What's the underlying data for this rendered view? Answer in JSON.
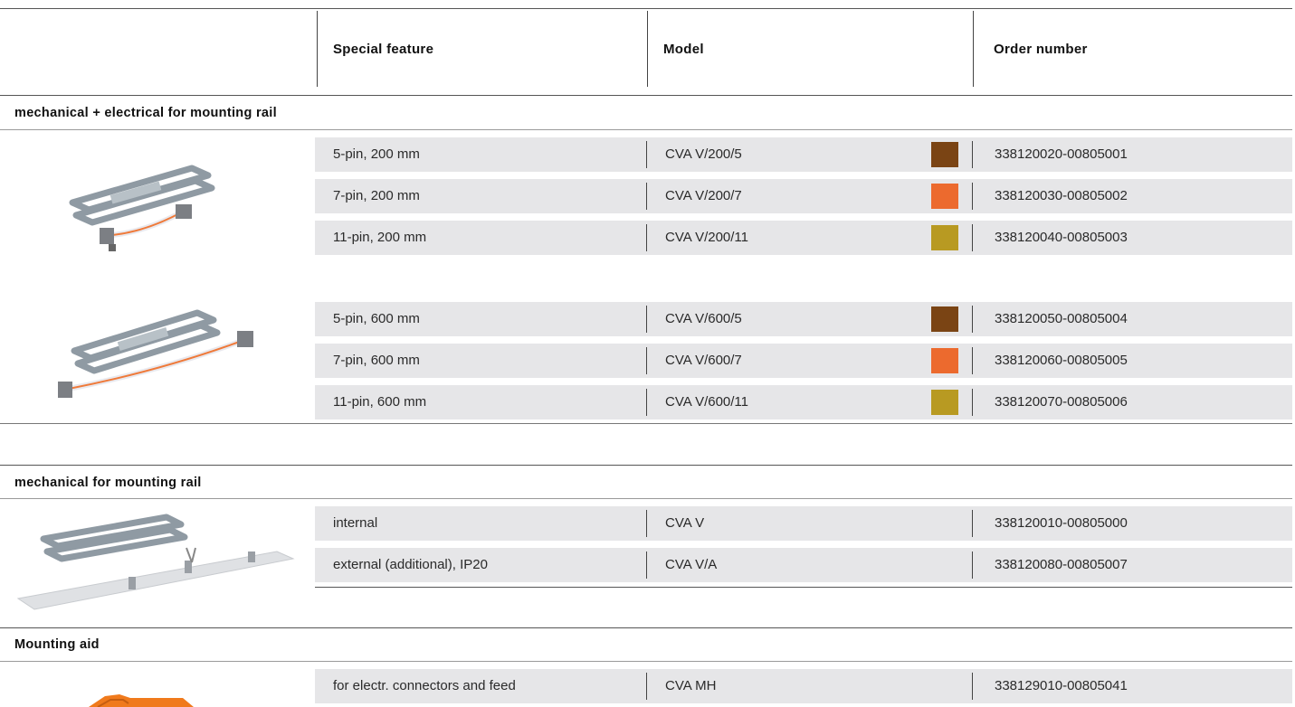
{
  "header": {
    "special_feature": "Special feature",
    "model": "Model",
    "order_number": "Order number"
  },
  "colors": {
    "brown": "#7a4414",
    "orange": "#ec6a2e",
    "ochre": "#b89a22",
    "row_bg": "#e6e6e8"
  },
  "sections": [
    {
      "title": "mechanical + electrical for mounting rail",
      "image_icon": "mounting-rail-connector-image",
      "rows": [
        {
          "feature": "5-pin, 200 mm",
          "model": "CVA V/200/5",
          "swatch": "#7a4414",
          "order": "338120020-00805001"
        },
        {
          "feature": "7-pin, 200 mm",
          "model": "CVA V/200/7",
          "swatch": "#ec6a2e",
          "order": "338120030-00805002"
        },
        {
          "feature": "11-pin, 200 mm",
          "model": "CVA V/200/11",
          "swatch": "#b89a22",
          "order": "338120040-00805003"
        },
        {
          "feature": "5-pin, 600 mm",
          "model": "CVA V/600/5",
          "swatch": "#7a4414",
          "order": "338120050-00805004"
        },
        {
          "feature": "7-pin, 600 mm",
          "model": "CVA V/600/7",
          "swatch": "#ec6a2e",
          "order": "338120060-00805005"
        },
        {
          "feature": "11-pin, 600 mm",
          "model": "CVA V/600/11",
          "swatch": "#b89a22",
          "order": "338120070-00805006"
        }
      ]
    },
    {
      "title": "mechanical for mounting rail",
      "image_icon": "mounting-rail-bracket-image",
      "rows": [
        {
          "feature": "internal",
          "model": "CVA V",
          "order": "338120010-00805000"
        },
        {
          "feature": "external (additional), IP20",
          "model": "CVA V/A",
          "order": "338120080-00805007"
        }
      ]
    },
    {
      "title": "Mounting aid",
      "image_icon": "mounting-aid-image",
      "rows": [
        {
          "feature": "for electr. connectors and feed",
          "model": "CVA MH",
          "order": "338129010-00805041"
        }
      ]
    }
  ]
}
